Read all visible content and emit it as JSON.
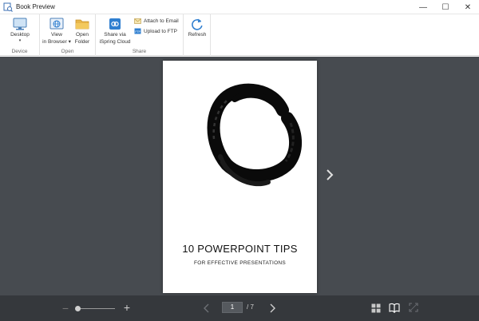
{
  "window": {
    "title": "Book Preview",
    "minimize": "—",
    "maximize": "☐",
    "close": "✕"
  },
  "ribbon": {
    "device": {
      "label": "Device",
      "desktop_label": "Desktop",
      "desktop_arrow": "▾"
    },
    "open": {
      "label": "Open",
      "view_in_browser_line1": "View",
      "view_in_browser_line2": "in Browser ▾",
      "open_folder_line1": "Open",
      "open_folder_line2": "Folder"
    },
    "share": {
      "label": "Share",
      "share_cloud_line1": "Share via",
      "share_cloud_line2": "iSpring Cloud",
      "attach_email": "Attach to Email",
      "upload_ftp": "Upload to FTP"
    },
    "refresh_label": "Refresh"
  },
  "book": {
    "title": "10 POWERPOINT TIPS",
    "subtitle": "FOR EFFECTIVE PRESENTATIONS"
  },
  "navigation": {
    "current_page": "1",
    "of_label": "/ 7",
    "zoom_minus": "−",
    "zoom_plus": "+",
    "zoom_level": 0.05
  },
  "colors": {
    "stage_bg": "#474b50",
    "bottombar_bg": "#35383c",
    "accent_blue": "#2f7fd0"
  }
}
